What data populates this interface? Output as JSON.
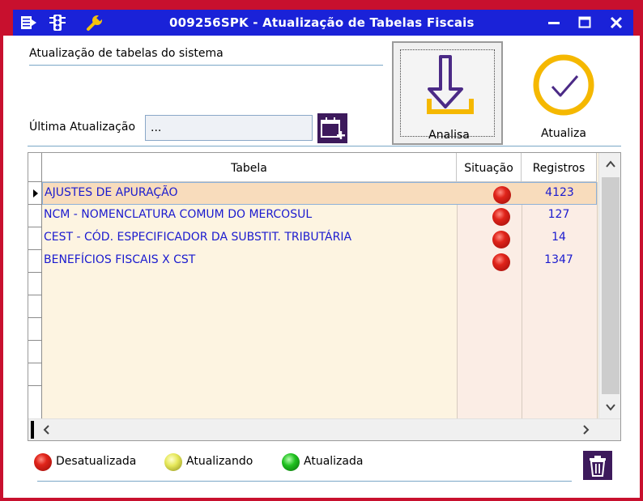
{
  "window": {
    "title": "009256SPK - Atualização de Tabelas Fiscais",
    "titlebar_color": "#1a22d8",
    "frame_color": "#c8102e",
    "toolbar_icons": [
      "menu-icon",
      "traffic-light-icon",
      "wrench-icon"
    ],
    "controls": [
      "minimize-icon",
      "maximize-icon",
      "close-icon"
    ]
  },
  "header": {
    "label": "Atualização de tabelas do sistema"
  },
  "actions": {
    "analisa_label": "Analisa",
    "atualiza_label": "Atualiza"
  },
  "last_update": {
    "label": "Última Atualização",
    "value": "..."
  },
  "grid": {
    "columns": [
      "Tabela",
      "Situação",
      "Registros"
    ],
    "rows": [
      {
        "tabela": "AJUSTES DE APURAÇÃO",
        "situacao": "Desatualizada",
        "registros": "4123",
        "selected": true
      },
      {
        "tabela": "NCM - NOMENCLATURA COMUM DO MERCOSUL",
        "situacao": "Desatualizada",
        "registros": "127",
        "selected": false
      },
      {
        "tabela": "CEST - CÓD. ESPECIFICADOR DA SUBSTIT. TRIBUTÁRIA",
        "situacao": "Desatualizada",
        "registros": "14",
        "selected": false
      },
      {
        "tabela": "BENEFÍCIOS FISCAIS X CST",
        "situacao": "Desatualizada",
        "registros": "1347",
        "selected": false
      }
    ],
    "row_text_color": "#1b1bcf",
    "selected_row_color": "#f8dcbc"
  },
  "legend": [
    {
      "label": "Desatualizada",
      "color": "#e0241a"
    },
    {
      "label": "Atualizando",
      "color": "#e6e85a"
    },
    {
      "label": "Atualizada",
      "color": "#1fc11f"
    }
  ]
}
